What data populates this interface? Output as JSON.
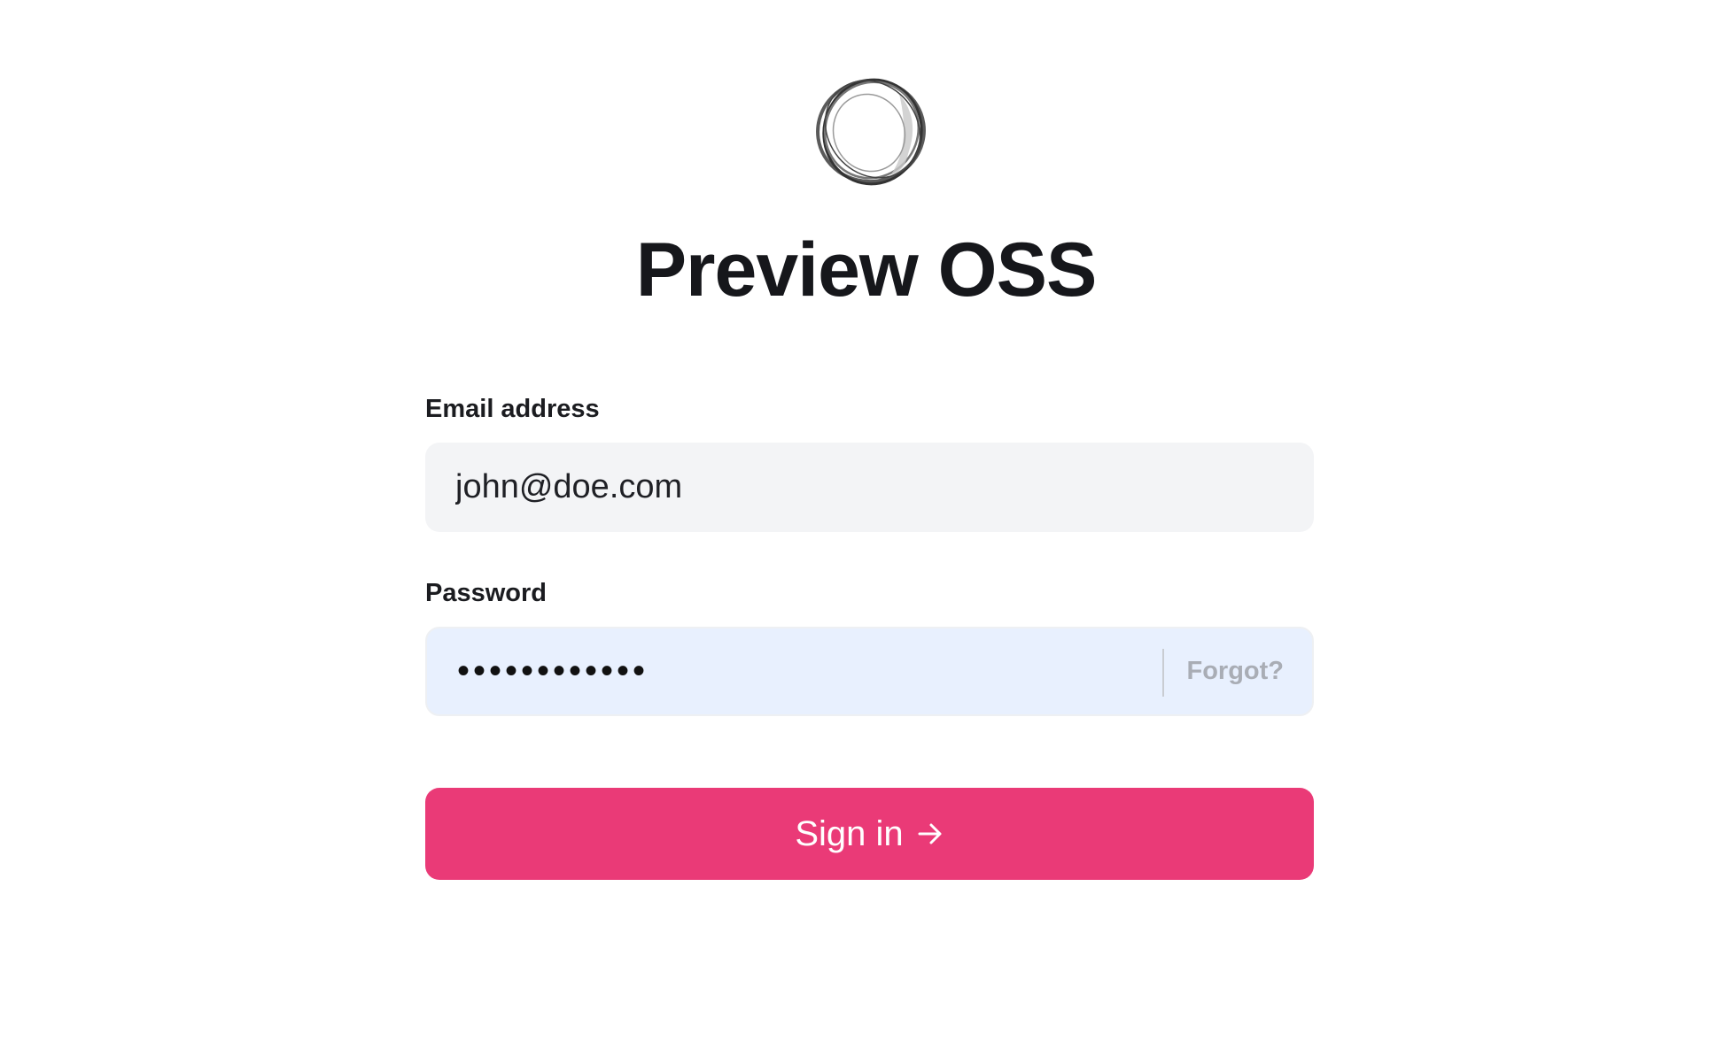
{
  "app": {
    "title": "Preview OSS",
    "logo_icon": "ring-logo-icon"
  },
  "form": {
    "email": {
      "label": "Email address",
      "value": "john@doe.com"
    },
    "password": {
      "label": "Password",
      "value": "password1234",
      "forgot_link": "Forgot?"
    },
    "submit": {
      "label": "Sign in",
      "icon": "arrow-right-icon"
    }
  },
  "colors": {
    "accent": "#ea3a77",
    "email_field_bg": "#f3f4f6",
    "password_field_bg": "#e8f0fe",
    "forgot_text": "#a9adb5"
  }
}
